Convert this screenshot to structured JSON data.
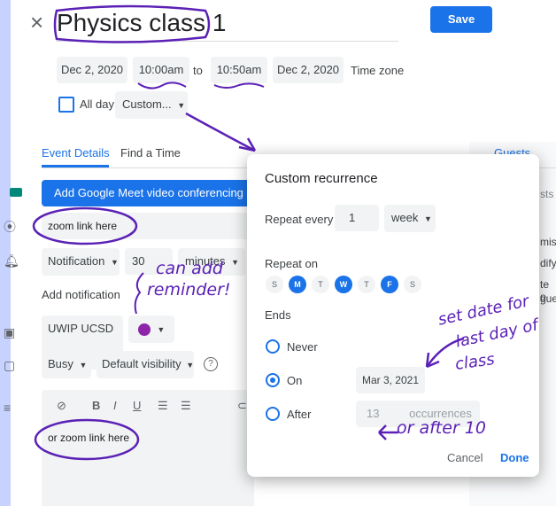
{
  "header": {
    "close_glyph": "×",
    "title": "Physics class 1",
    "save_label": "Save"
  },
  "datetime": {
    "start_date": "Dec 2, 2020",
    "start_time": "10:00am",
    "to_label": "to",
    "end_time": "10:50am",
    "end_date": "Dec 2, 2020",
    "timezone_label": "Time zone",
    "all_day_label": "All day",
    "recurrence_label": "Custom..."
  },
  "tabs": {
    "event_details": "Event Details",
    "find_time": "Find a Time",
    "guests": "Guests"
  },
  "form": {
    "meet_label": "Add Google Meet video conferencing",
    "location_value": "zoom link here",
    "notification_type": "Notification",
    "notification_value": "30",
    "notification_unit": "minutes",
    "add_notification": "Add notification",
    "calendar_name": "UWIP UCSD",
    "busy_label": "Busy",
    "visibility_label": "Default visibility",
    "description_text": "or zoom link here",
    "calendar_color": "#8e24aa"
  },
  "guests_partial": {
    "line1": "sts",
    "line2": "mis",
    "line3": "dify",
    "line4": "te o",
    "line5": "gue"
  },
  "dialog": {
    "title": "Custom recurrence",
    "repeat_every_label": "Repeat every",
    "repeat_count": "1",
    "repeat_unit": "week",
    "repeat_on_label": "Repeat on",
    "days": [
      {
        "letter": "S",
        "selected": false
      },
      {
        "letter": "M",
        "selected": true
      },
      {
        "letter": "T",
        "selected": false
      },
      {
        "letter": "W",
        "selected": true
      },
      {
        "letter": "T",
        "selected": false
      },
      {
        "letter": "F",
        "selected": true
      },
      {
        "letter": "S",
        "selected": false
      }
    ],
    "ends_label": "Ends",
    "never_label": "Never",
    "on_label": "On",
    "on_date": "Mar 3, 2021",
    "after_label": "After",
    "after_count": "13",
    "occurrences_label": "occurrences",
    "cancel_label": "Cancel",
    "done_label": "Done",
    "selected_end": "On"
  },
  "annotations": {
    "reminder_note_1": "can add",
    "reminder_note_2": "reminder!",
    "date_note_1": "set date for",
    "date_note_2": "last day of",
    "date_note_3": "class",
    "after_note": "or after 10"
  },
  "colors": {
    "accent": "#1a73e8",
    "ink": "#5b21b6",
    "left_strip": "#c7d2fe",
    "right_panel": "#f1f3f4"
  }
}
